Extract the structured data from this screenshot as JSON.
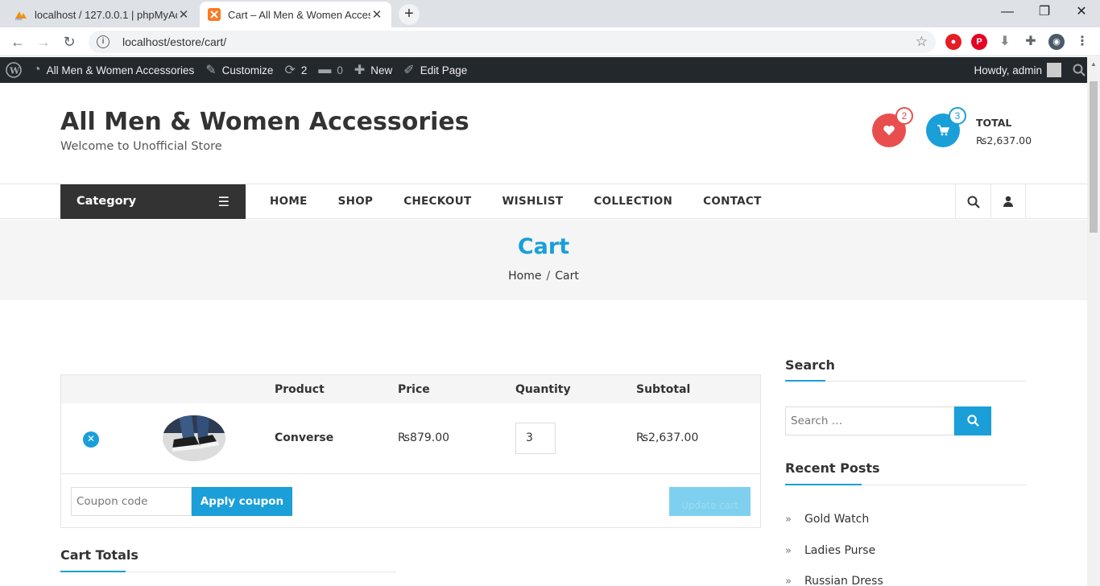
{
  "browser": {
    "tabs": [
      {
        "title": "localhost / 127.0.0.1 | phpMyAdm",
        "active": false
      },
      {
        "title": "Cart – All Men & Women Accesso",
        "active": true
      }
    ],
    "new_tab": "+",
    "window_controls": {
      "minimize": "—",
      "maximize": "❐",
      "close": "✕"
    },
    "nav": {
      "back": "←",
      "forward": "→",
      "reload": "↻"
    },
    "url": "localhost/estore/cart/"
  },
  "admin_bar": {
    "site_name": "All Men & Women Accessories",
    "customize": "Customize",
    "updates_count": "2",
    "comments_count": "0",
    "new": "New",
    "edit_page": "Edit Page",
    "howdy": "Howdy, admin"
  },
  "site": {
    "title": "All Men & Women Accessories",
    "tagline": "Welcome to Unofficial Store"
  },
  "header": {
    "wishlist_count": "2",
    "cart_count": "3",
    "total_label": "TOTAL",
    "total_value": "₨2,637.00"
  },
  "nav": {
    "category": "Category",
    "items": [
      "HOME",
      "SHOP",
      "CHECKOUT",
      "WISHLIST",
      "COLLECTION",
      "CONTACT"
    ]
  },
  "banner": {
    "title": "Cart",
    "breadcrumb_home": "Home",
    "breadcrumb_sep": "/",
    "breadcrumb_current": "Cart"
  },
  "cart": {
    "headers": {
      "product": "Product",
      "price": "Price",
      "quantity": "Quantity",
      "subtotal": "Subtotal"
    },
    "row": {
      "name": "Converse",
      "price": "₨879.00",
      "quantity": "3",
      "subtotal": "₨2,637.00"
    },
    "coupon_placeholder": "Coupon code",
    "apply_coupon": "Apply coupon",
    "update_cart": "Update cart",
    "totals_title": "Cart Totals"
  },
  "sidebar": {
    "search_title": "Search",
    "search_placeholder": "Search …",
    "recent_posts_title": "Recent Posts",
    "posts": [
      "Gold Watch",
      "Ladies Purse",
      "Russian Dress"
    ]
  },
  "colors": {
    "accent": "#1a9fd8",
    "wishlist": "#e94e4e",
    "admin_bar": "#23282d"
  }
}
